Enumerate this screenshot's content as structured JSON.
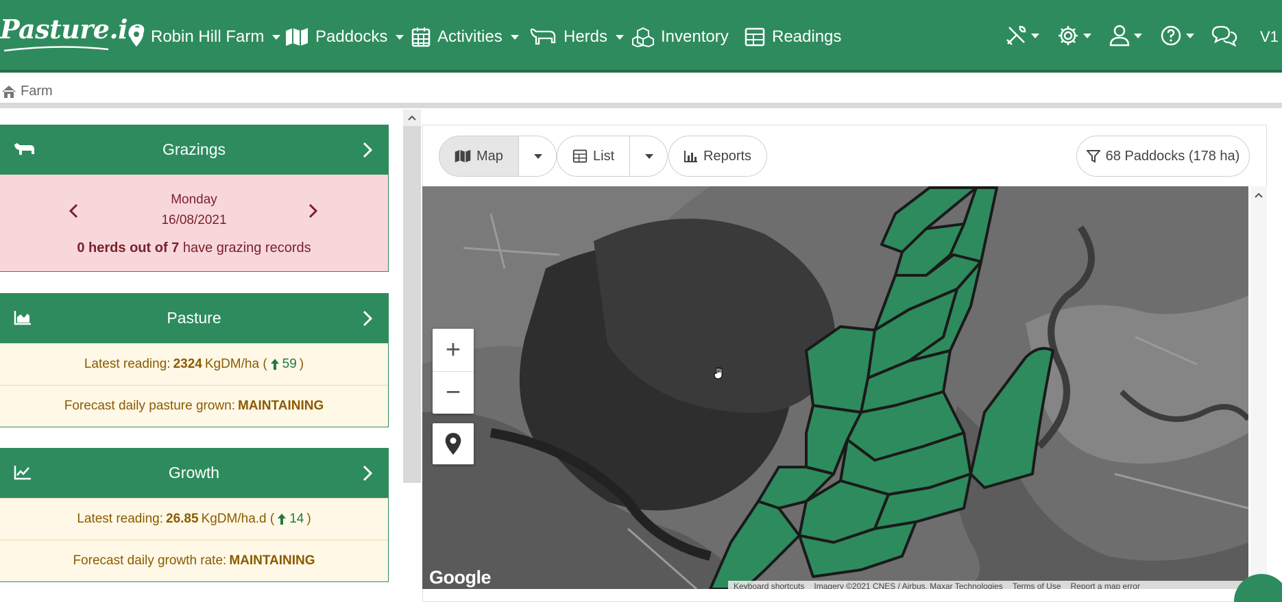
{
  "brand": {
    "name": "Pasture.io"
  },
  "nav": {
    "farm": "Robin Hill Farm",
    "paddocks": "Paddocks",
    "activities": "Activities",
    "herds": "Herds",
    "inventory": "Inventory",
    "readings": "Readings",
    "version": "V1"
  },
  "breadcrumb": {
    "home": "Farm"
  },
  "grazings": {
    "title": "Grazings",
    "day": "Monday",
    "date": "16/08/2021",
    "count_text": "0 herds out of 7",
    "suffix": "have grazing records"
  },
  "pasture": {
    "title": "Pasture",
    "latest_label": "Latest reading:",
    "latest_value": "2324",
    "latest_unit": "KgDM/ha (",
    "latest_change": "59",
    "latest_close": ")",
    "forecast_label": "Forecast daily pasture grown:",
    "forecast_value": "MAINTAINING"
  },
  "growth": {
    "title": "Growth",
    "latest_label": "Latest reading:",
    "latest_value": "26.85",
    "latest_unit": "KgDM/ha.d (",
    "latest_change": "14",
    "latest_close": ")",
    "forecast_label": "Forecast daily growth rate:",
    "forecast_value": "MAINTAINING"
  },
  "toolbar": {
    "map": "Map",
    "list": "List",
    "reports": "Reports",
    "filter": "68 Paddocks (178 ha)"
  },
  "map": {
    "google": "Google",
    "attribution": [
      "Keyboard shortcuts",
      "Imagery ©2021 CNES / Airbus, Maxar Technologies",
      "Terms of Use",
      "Report a map error"
    ]
  },
  "colors": {
    "brand_green": "#2e8b5e",
    "alert_bg": "#f8d7da",
    "info_bg": "#fff8e6"
  }
}
